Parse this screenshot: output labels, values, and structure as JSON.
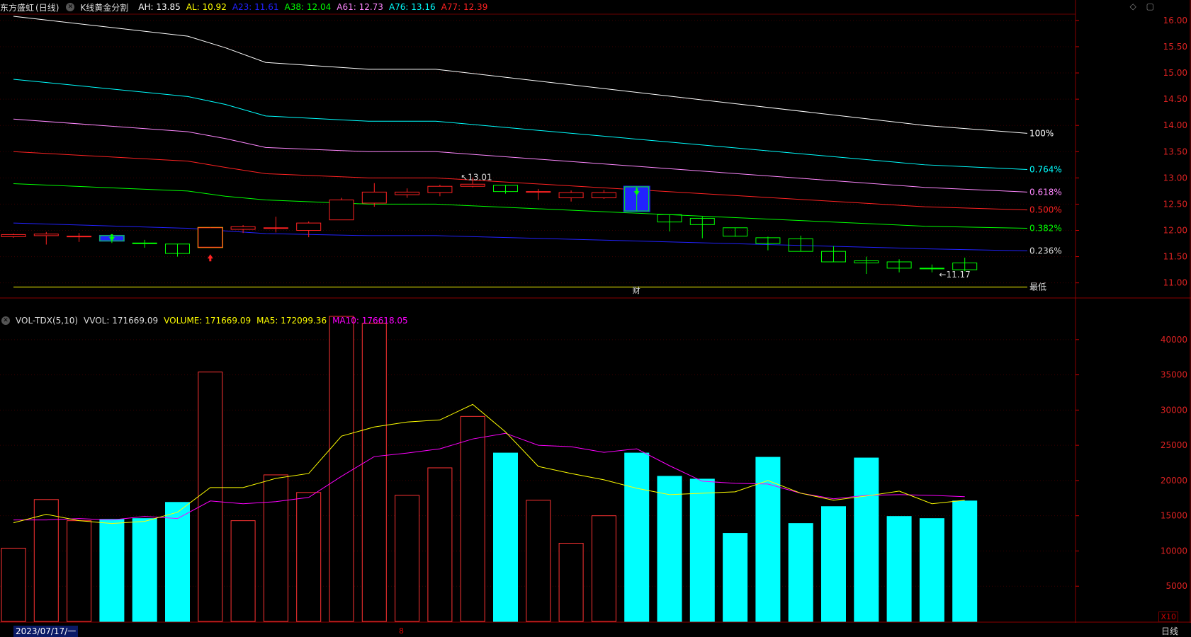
{
  "header": {
    "stock_name": "东方盛虹",
    "period_label": "(日线)",
    "indicator_name": "K线黄金分割",
    "values": [
      {
        "label": "AH: 13.85",
        "color": "#ffffff"
      },
      {
        "label": "AL: 10.92",
        "color": "#ffff00"
      },
      {
        "label": "A23: 11.61",
        "color": "#2222ff"
      },
      {
        "label": "A38: 12.04",
        "color": "#00ff00"
      },
      {
        "label": "A61: 12.73",
        "color": "#ff88ff"
      },
      {
        "label": "A76: 13.16",
        "color": "#00ffff"
      },
      {
        "label": "A77: 12.39",
        "color": "#ff2222"
      }
    ]
  },
  "volume_header": {
    "indicator": "VOL-TDX(5,10)",
    "vvol": "VVOL: 171669.09",
    "volume": "VOLUME: 171669.09",
    "ma5": "MA5: 172099.36",
    "ma10": "MA10: 176618.05",
    "colors": {
      "vvol": "#dddddd",
      "volume": "#ffff00",
      "ma5": "#ffff00",
      "ma10": "#ff00ff"
    }
  },
  "top_right_icons": [
    "diamond-icon",
    "window-icon"
  ],
  "price_axis": {
    "ticks": [
      "16.00",
      "15.50",
      "15.00",
      "14.50",
      "14.00",
      "13.50",
      "13.00",
      "12.50",
      "12.00",
      "11.50",
      "11.00"
    ],
    "min": 10.82,
    "max": 16.12
  },
  "volume_axis": {
    "ticks": [
      "40000",
      "35000",
      "30000",
      "25000",
      "20000",
      "15000",
      "10000",
      "5000"
    ],
    "min": 0,
    "max": 44000,
    "unit_badge": "X10"
  },
  "fib_levels": [
    {
      "name": "100%",
      "color": "#ffffff",
      "values": [
        16.08,
        15.7,
        15.48,
        15.2,
        15.07,
        15.07,
        14.0,
        13.85
      ]
    },
    {
      "name": "0.764%",
      "color": "#00ffff",
      "values": [
        14.88,
        14.55,
        14.4,
        14.18,
        14.08,
        14.08,
        13.25,
        13.16
      ]
    },
    {
      "name": "0.618%",
      "color": "#ff88ff",
      "values": [
        14.12,
        13.88,
        13.75,
        13.58,
        13.5,
        13.5,
        12.82,
        12.73
      ]
    },
    {
      "name": "0.500%",
      "color": "#ff2222",
      "values": [
        13.5,
        13.32,
        13.2,
        13.08,
        13.0,
        13.0,
        12.45,
        12.39
      ]
    },
    {
      "name": "0.382%",
      "color": "#00ff00",
      "values": [
        12.89,
        12.75,
        12.65,
        12.58,
        12.5,
        12.5,
        12.08,
        12.04
      ]
    },
    {
      "name": "0.236%",
      "color": "#2222ff",
      "values": [
        12.14,
        12.04,
        11.99,
        11.94,
        11.9,
        11.9,
        11.65,
        11.61
      ]
    },
    {
      "name": "最低",
      "color": "#ffff00",
      "values": [
        10.92,
        10.92,
        10.92,
        10.92,
        10.92,
        10.92,
        10.92,
        10.92
      ]
    }
  ],
  "candles": [
    {
      "o": 11.88,
      "c": 11.92,
      "h": 11.94,
      "l": 11.86
    },
    {
      "o": 11.9,
      "c": 11.93,
      "h": 11.97,
      "l": 11.73
    },
    {
      "o": 11.88,
      "c": 11.89,
      "h": 11.95,
      "l": 11.78
    },
    {
      "o": 11.9,
      "c": 11.8,
      "h": 11.9,
      "l": 11.76
    },
    {
      "o": 11.76,
      "c": 11.75,
      "h": 11.82,
      "l": 11.67
    },
    {
      "o": 11.74,
      "c": 11.56,
      "h": 11.74,
      "l": 11.5
    },
    {
      "o": 11.68,
      "c": 12.05,
      "h": 12.06,
      "l": 11.68
    },
    {
      "o": 12.02,
      "c": 12.07,
      "h": 12.1,
      "l": 11.95
    },
    {
      "o": 12.04,
      "c": 12.05,
      "h": 12.26,
      "l": 11.96
    },
    {
      "o": 12.0,
      "c": 12.14,
      "h": 12.17,
      "l": 11.87
    },
    {
      "o": 12.2,
      "c": 12.58,
      "h": 12.62,
      "l": 12.2
    },
    {
      "o": 12.52,
      "c": 12.73,
      "h": 12.9,
      "l": 12.45
    },
    {
      "o": 12.68,
      "c": 12.73,
      "h": 12.8,
      "l": 12.62
    },
    {
      "o": 12.72,
      "c": 12.84,
      "h": 12.87,
      "l": 12.65
    },
    {
      "o": 12.84,
      "c": 12.88,
      "h": 13.01,
      "l": 12.82
    },
    {
      "o": 12.86,
      "c": 12.74,
      "h": 12.86,
      "l": 12.7
    },
    {
      "o": 12.73,
      "c": 12.74,
      "h": 12.79,
      "l": 12.58
    },
    {
      "o": 12.62,
      "c": 12.72,
      "h": 12.76,
      "l": 12.55
    },
    {
      "o": 12.62,
      "c": 12.72,
      "h": 12.77,
      "l": 12.6
    },
    {
      "o": 12.83,
      "c": 12.37,
      "h": 12.83,
      "l": 12.37
    },
    {
      "o": 12.3,
      "c": 12.16,
      "h": 12.3,
      "l": 11.98
    },
    {
      "o": 12.23,
      "c": 12.11,
      "h": 12.26,
      "l": 11.85
    },
    {
      "o": 12.05,
      "c": 11.89,
      "h": 12.05,
      "l": 11.88
    },
    {
      "o": 11.86,
      "c": 11.75,
      "h": 11.88,
      "l": 11.62
    },
    {
      "o": 11.84,
      "c": 11.6,
      "h": 11.9,
      "l": 11.6
    },
    {
      "o": 11.6,
      "c": 11.4,
      "h": 11.7,
      "l": 11.4
    },
    {
      "o": 11.42,
      "c": 11.38,
      "h": 11.5,
      "l": 11.17
    },
    {
      "o": 11.4,
      "c": 11.28,
      "h": 11.45,
      "l": 11.2
    },
    {
      "o": 11.28,
      "c": 11.27,
      "h": 11.35,
      "l": 11.2
    },
    {
      "o": 11.38,
      "c": 11.25,
      "h": 11.48,
      "l": 11.22
    }
  ],
  "candle_highlights": [
    {
      "index": 3,
      "color": "#2222ff"
    },
    {
      "index": 6,
      "color": "#ffff00"
    },
    {
      "index": 19,
      "color": "#2222ff"
    }
  ],
  "signals": [
    {
      "index": 3,
      "type": "sell",
      "color": "#00ff00"
    },
    {
      "index": 6,
      "type": "buy",
      "color": "#ff2222"
    },
    {
      "index": 19,
      "type": "sell",
      "color": "#00ff00"
    }
  ],
  "annotations": {
    "high": "13.01",
    "low": "11.17",
    "event_mark": "财",
    "event_index": 19
  },
  "volume": {
    "bars": [
      10400,
      17300,
      14300,
      14500,
      14600,
      16900,
      35400,
      14300,
      20800,
      18300,
      43300,
      42300,
      17900,
      21800,
      29100,
      23900,
      17200,
      11100,
      15000,
      23900,
      20600,
      20200,
      12500,
      23300,
      13900,
      16300,
      23200,
      14900,
      14600,
      17100
    ],
    "ma5": [
      14000,
      15200,
      14300,
      13900,
      14200,
      15500,
      19000,
      19000,
      20300,
      21000,
      26300,
      27600,
      28300,
      28600,
      30800,
      26900,
      22000,
      21000,
      20100,
      18900,
      18000,
      18200,
      18400,
      20000,
      18200,
      17200,
      17800,
      18500,
      16700,
      17200
    ],
    "ma10": [
      14400,
      14400,
      14600,
      14400,
      14900,
      14600,
      17100,
      16700,
      17000,
      17600,
      20600,
      23400,
      23900,
      24500,
      25900,
      26700,
      25000,
      24800,
      24000,
      24500,
      22100,
      19900,
      19600,
      19500,
      18200,
      17400,
      17900,
      18000,
      17900,
      17700
    ]
  },
  "bottom": {
    "date": "2023/07/17/一",
    "month_mark": "8",
    "period": "日线"
  }
}
